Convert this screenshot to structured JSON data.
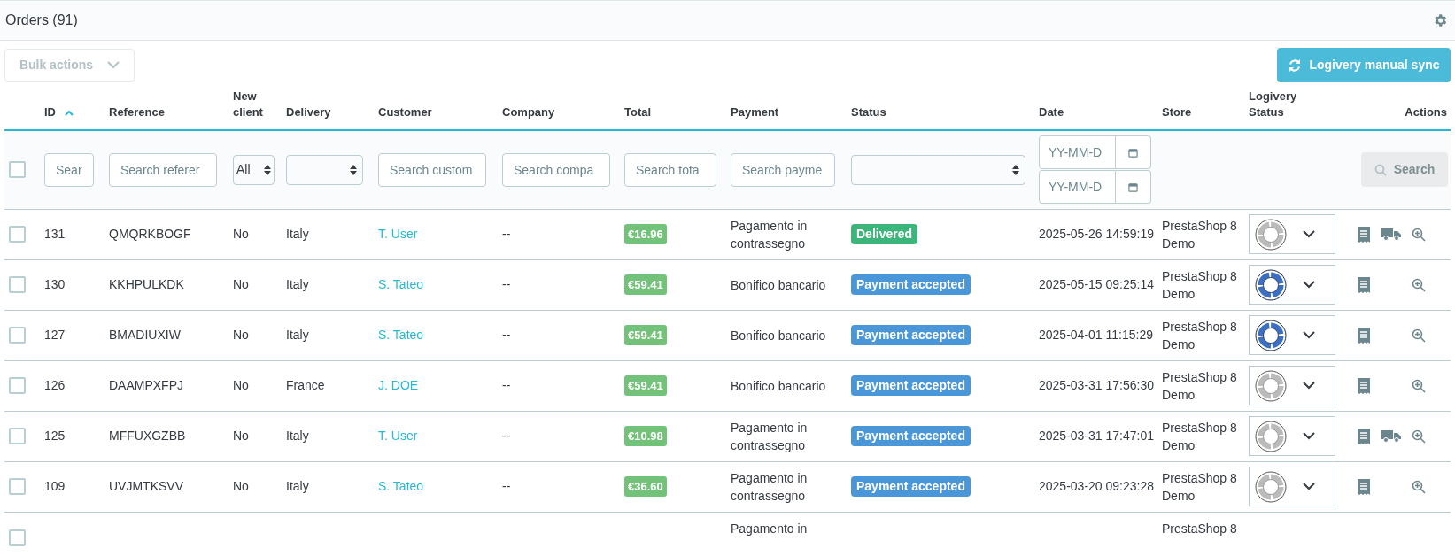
{
  "header": {
    "title": "Orders (91)"
  },
  "toolbar": {
    "bulk_actions": "Bulk actions",
    "sync_button": "Logivery manual sync"
  },
  "table": {
    "columns": [
      {
        "label": "ID",
        "sorted": true
      },
      {
        "label": "Reference",
        "sorted": false
      },
      {
        "label": "New client",
        "sorted": false
      },
      {
        "label": "Delivery",
        "sorted": false
      },
      {
        "label": "Customer",
        "sorted": false
      },
      {
        "label": "Company",
        "sorted": false
      },
      {
        "label": "Total",
        "sorted": false
      },
      {
        "label": "Payment",
        "sorted": false
      },
      {
        "label": "Status",
        "sorted": false
      },
      {
        "label": "Date",
        "sorted": false
      },
      {
        "label": "Store",
        "sorted": false
      },
      {
        "label": "Logivery Status",
        "sorted": false
      },
      {
        "label": "Actions",
        "sorted": false
      }
    ],
    "filters": {
      "select_all": {
        "checked": false
      },
      "id": {
        "placeholder": "Sear"
      },
      "reference": {
        "placeholder": "Search referer"
      },
      "new_client": "All",
      "customer": {
        "placeholder": "Search custom"
      },
      "company": {
        "placeholder": "Search compa"
      },
      "total": {
        "placeholder": "Search tota"
      },
      "payment": {
        "placeholder": "Search payme"
      },
      "date_from": {
        "placeholder": "YY-MM-D"
      },
      "date_to": {
        "placeholder": "YY-MM-D"
      },
      "search_button": "Search"
    },
    "rows": [
      {
        "checked": false,
        "id": "131",
        "reference": "QMQRKBOGF",
        "new_client": "No",
        "delivery": "Italy",
        "customer": "T. User",
        "company": "--",
        "total": "€16.96",
        "payment": [
          "Pagamento in",
          "contrassegno"
        ],
        "status": {
          "label": "Delivered",
          "color": "#3cb57a"
        },
        "date": "2025-05-26 14:59:19",
        "store": [
          "PrestaShop 8",
          "Demo"
        ],
        "logivery": {
          "kind": "pending"
        },
        "shippable": true
      },
      {
        "checked": false,
        "id": "130",
        "reference": "KKHPULKDK",
        "new_client": "No",
        "delivery": "Italy",
        "customer": "S. Tateo",
        "company": "--",
        "total": "€59.41",
        "payment": [
          "Bonifico bancario"
        ],
        "status": {
          "label": "Payment accepted",
          "color": "#4996d9"
        },
        "date": "2025-05-15 09:25:14",
        "store": [
          "PrestaShop 8",
          "Demo"
        ],
        "logivery": {
          "kind": "active"
        },
        "shippable": false
      },
      {
        "checked": false,
        "id": "127",
        "reference": "BMADIUXIW",
        "new_client": "No",
        "delivery": "Italy",
        "customer": "S. Tateo",
        "company": "--",
        "total": "€59.41",
        "payment": [
          "Bonifico bancario"
        ],
        "status": {
          "label": "Payment accepted",
          "color": "#4996d9"
        },
        "date": "2025-04-01 11:15:29",
        "store": [
          "PrestaShop 8",
          "Demo"
        ],
        "logivery": {
          "kind": "active"
        },
        "shippable": false
      },
      {
        "checked": false,
        "id": "126",
        "reference": "DAAMPXFPJ",
        "new_client": "No",
        "delivery": "France",
        "customer": "J. DOE",
        "company": "--",
        "total": "€59.41",
        "payment": [
          "Bonifico bancario"
        ],
        "status": {
          "label": "Payment accepted",
          "color": "#4996d9"
        },
        "date": "2025-03-31 17:56:30",
        "store": [
          "PrestaShop 8",
          "Demo"
        ],
        "logivery": {
          "kind": "pending"
        },
        "shippable": false
      },
      {
        "checked": false,
        "id": "125",
        "reference": "MFFUXGZBB",
        "new_client": "No",
        "delivery": "Italy",
        "customer": "T. User",
        "company": "--",
        "total": "€10.98",
        "payment": [
          "Pagamento in",
          "contrassegno"
        ],
        "status": {
          "label": "Payment accepted",
          "color": "#4996d9"
        },
        "date": "2025-03-31 17:47:01",
        "store": [
          "PrestaShop 8",
          "Demo"
        ],
        "logivery": {
          "kind": "pending"
        },
        "shippable": true
      },
      {
        "checked": false,
        "id": "109",
        "reference": "UVJMTKSVV",
        "new_client": "No",
        "delivery": "Italy",
        "customer": "S. Tateo",
        "company": "--",
        "total": "€36.60",
        "payment": [
          "Pagamento in",
          "contrassegno"
        ],
        "status": {
          "label": "Payment accepted",
          "color": "#4996d9"
        },
        "date": "2025-03-20 09:23:28",
        "store": [
          "PrestaShop 8",
          "Demo"
        ],
        "logivery": {
          "kind": "pending"
        },
        "shippable": false
      }
    ],
    "partial_row": {
      "checked": false,
      "payment": "Pagamento in",
      "store": "PrestaShop 8"
    }
  }
}
